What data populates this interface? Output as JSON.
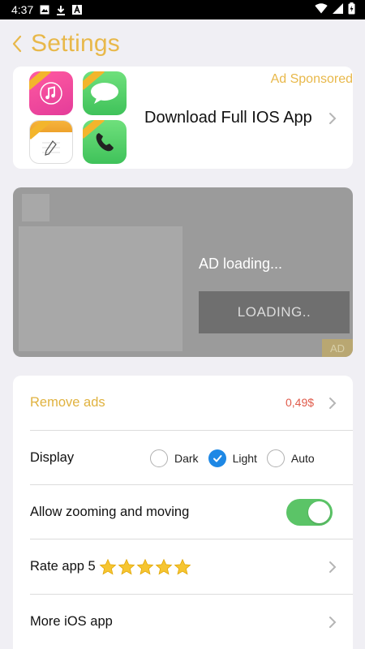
{
  "status_bar": {
    "time": "4:37",
    "icons_left": [
      "gallery-icon",
      "download-icon",
      "font-icon"
    ],
    "icons_right": [
      "wifi-icon",
      "signal-icon",
      "battery-icon"
    ]
  },
  "header": {
    "back_icon": "chevron-left-icon",
    "title": "Settings"
  },
  "promo": {
    "title": "Download Full IOS App",
    "sponsored_label": "Ad Sponsored",
    "apps": [
      "music",
      "messages",
      "notes",
      "phone"
    ]
  },
  "ad": {
    "loading_text": "AD loading...",
    "button_text": "LOADING..",
    "badge": "AD"
  },
  "settings": {
    "remove_ads": {
      "label": "Remove ads",
      "price": "0,49$"
    },
    "display": {
      "label": "Display",
      "options": [
        {
          "label": "Dark",
          "selected": false
        },
        {
          "label": "Light",
          "selected": true
        },
        {
          "label": "Auto",
          "selected": false
        }
      ]
    },
    "zoom": {
      "label": "Allow zooming and moving",
      "enabled": true
    },
    "rate": {
      "label": "Rate app 5",
      "stars": 5
    },
    "more": {
      "label": "More iOS app"
    }
  },
  "colors": {
    "accent_gold": "#e8b84a",
    "price_red": "#e05a4a",
    "radio_blue": "#1e88e5",
    "toggle_green": "#5bc467",
    "background": "#f0eff4"
  }
}
